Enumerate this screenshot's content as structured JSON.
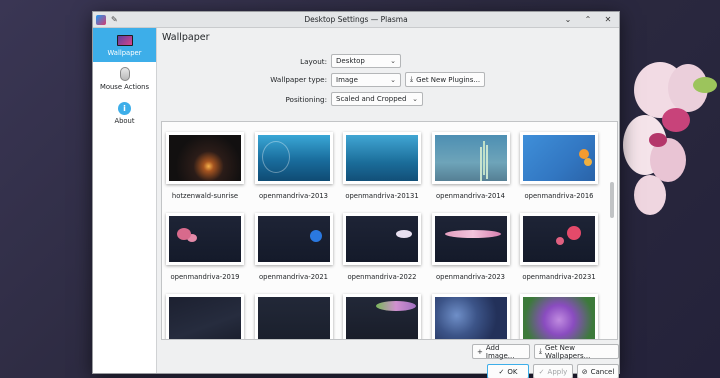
{
  "window": {
    "title": "Desktop Settings — Plasma",
    "controls": {
      "minimize": "⌄",
      "maximize": "⌃",
      "close": "✕"
    }
  },
  "sidebar": {
    "items": [
      {
        "label": "Wallpaper",
        "icon": "monitor-icon",
        "active": true
      },
      {
        "label": "Mouse Actions",
        "icon": "mouse-icon",
        "active": false
      },
      {
        "label": "About",
        "icon": "info-icon",
        "active": false
      }
    ]
  },
  "main": {
    "title": "Wallpaper",
    "layout": {
      "label": "Layout:",
      "value": "Desktop"
    },
    "wallpaper_type": {
      "label": "Wallpaper type:",
      "value": "Image"
    },
    "get_new_plugins": "Get New Plugins...",
    "positioning": {
      "label": "Positioning:",
      "value": "Scaled and Cropped"
    }
  },
  "wallpapers": [
    "hotzenwald-sunrise",
    "openmandriva-2013",
    "openmandriva-20131",
    "openmandriva-2014",
    "openmandriva-2016",
    "openmandriva-2019",
    "openmandriva-2021",
    "openmandriva-2022",
    "openmandriva-2023",
    "openmandriva-20231",
    "",
    "",
    "",
    "",
    ""
  ],
  "actions": {
    "add_image": "Add Image...",
    "get_new_wallpapers": "Get New Wallpapers...",
    "ok": "OK",
    "apply": "Apply",
    "cancel": "Cancel"
  },
  "colors": {
    "accent": "#3daee9",
    "window_bg": "#eff0f1"
  }
}
